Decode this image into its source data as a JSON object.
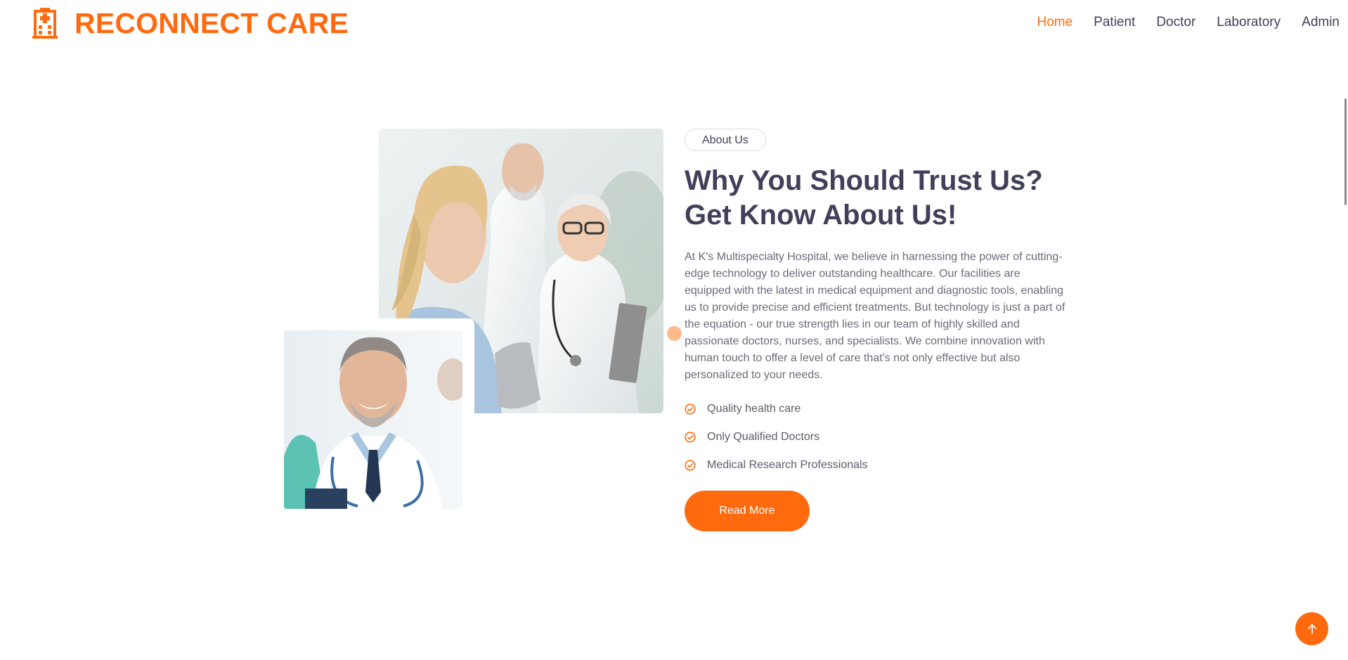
{
  "brand": {
    "name": "RECONNECT CARE",
    "icon": "hospital-building-icon"
  },
  "nav": {
    "items": [
      {
        "label": "Home",
        "active": true
      },
      {
        "label": "Patient",
        "active": false
      },
      {
        "label": "Doctor",
        "active": false
      },
      {
        "label": "Laboratory",
        "active": false
      },
      {
        "label": "Admin",
        "active": false
      }
    ]
  },
  "about": {
    "badge": "About Us",
    "heading_line1": "Why You Should Trust Us?",
    "heading_line2": "Get Know About Us!",
    "paragraph": "At K's Multispecialty Hospital, we believe in harnessing the power of cutting-edge technology to deliver outstanding healthcare. Our facilities are equipped with the latest in medical equipment and diagnostic tools, enabling us to provide precise and efficient treatments. But technology is just a part of the equation - our true strength lies in our team of highly skilled and passionate doctors, nurses, and specialists. We combine innovation with human touch to offer a level of care that's not only effective but also personalized to your needs.",
    "features": [
      "Quality health care",
      "Only Qualified Doctors",
      "Medical Research Professionals"
    ],
    "read_more_label": "Read More"
  },
  "colors": {
    "accent": "#ff6a0e",
    "heading": "#40405a",
    "body_text": "#6b6b7b",
    "accent_light": "#ffb98a"
  },
  "icons": {
    "feature": "check-circle-icon",
    "back_to_top": "arrow-up-icon"
  }
}
